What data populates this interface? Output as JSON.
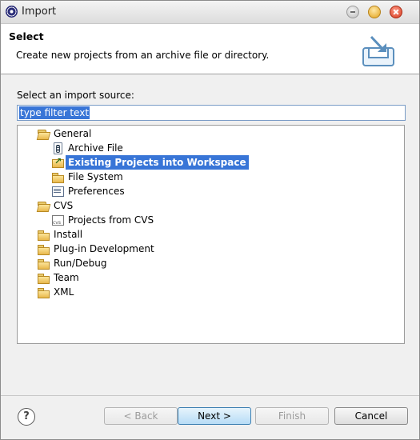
{
  "window": {
    "title": "Import"
  },
  "header": {
    "title": "Select",
    "description": "Create new projects from an archive file or directory.",
    "icon": "import-wizard-icon"
  },
  "source": {
    "label": "Select an import source:",
    "filter_placeholder": "type filter text",
    "filter_value": ""
  },
  "tree": [
    {
      "label": "General",
      "icon": "folder-open-icon"
    },
    {
      "label": "Archive File",
      "icon": "archive-file-icon"
    },
    {
      "label": "Existing Projects into Workspace",
      "icon": "projects-icon",
      "selected": true
    },
    {
      "label": "File System",
      "icon": "folder-icon"
    },
    {
      "label": "Preferences",
      "icon": "preferences-icon"
    },
    {
      "label": "CVS",
      "icon": "folder-open-icon"
    },
    {
      "label": "Projects from CVS",
      "icon": "cvs-project-icon"
    },
    {
      "label": "Install",
      "icon": "folder-icon"
    },
    {
      "label": "Plug-in Development",
      "icon": "folder-icon"
    },
    {
      "label": "Run/Debug",
      "icon": "folder-icon"
    },
    {
      "label": "Team",
      "icon": "folder-icon"
    },
    {
      "label": "XML",
      "icon": "folder-icon"
    }
  ],
  "buttons": {
    "help": "?",
    "back": "< Back",
    "next": "Next >",
    "finish": "Finish",
    "cancel": "Cancel"
  },
  "colors": {
    "selection": "#3875d7",
    "primary_button": "#b7dcf6"
  }
}
